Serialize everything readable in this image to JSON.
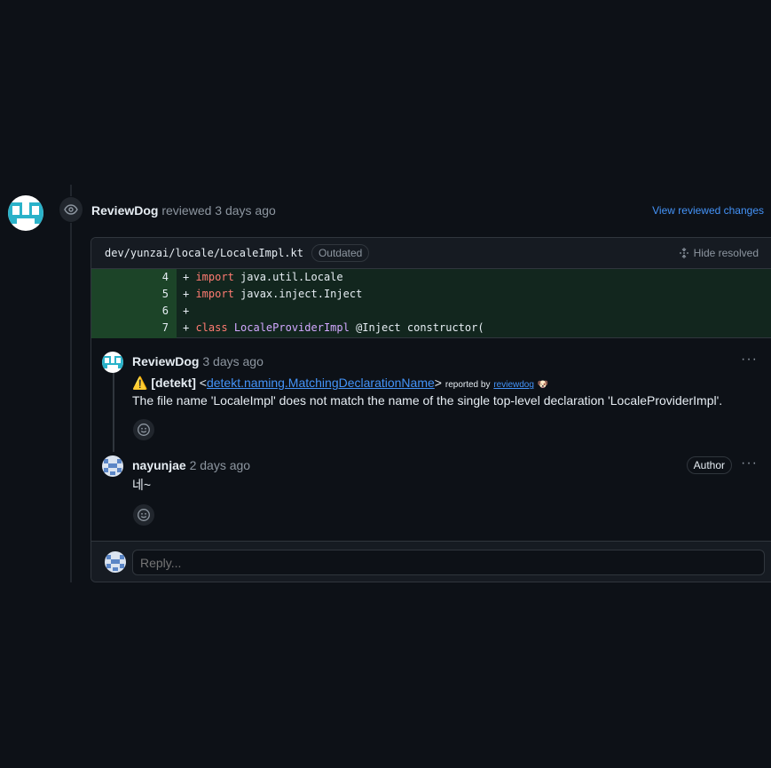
{
  "review": {
    "author": "ReviewDog",
    "action": "reviewed",
    "time": "3 days ago",
    "view_changes_label": "View reviewed changes"
  },
  "file": {
    "path": "dev/yunzai/locale/LocaleImpl.kt",
    "status_badge": "Outdated",
    "hide_resolved_label": "Hide resolved"
  },
  "diff": {
    "lines": [
      {
        "number": "4",
        "prefix": "+ ",
        "keyword": "import",
        "rest": " java.util.Locale"
      },
      {
        "number": "5",
        "prefix": "+ ",
        "keyword": "import",
        "rest": " javax.inject.Inject"
      },
      {
        "number": "6",
        "prefix": "+",
        "keyword": "",
        "rest": ""
      },
      {
        "number": "7",
        "prefix": "+ ",
        "keyword": "class",
        "classname": "LocaleProviderImpl",
        "rest": " @Inject constructor("
      }
    ]
  },
  "comments": [
    {
      "author": "ReviewDog",
      "time": "3 days ago",
      "warning_icon": "⚠️",
      "tag": "[detekt]",
      "open_angle": "<",
      "rule_link": "detekt.naming.MatchingDeclarationName",
      "close_angle": ">",
      "reported_by": "reported by",
      "reporter_link": "reviewdog",
      "reporter_emoji": "🐶",
      "message": "The file name 'LocaleImpl' does not match the name of the single top-level declaration 'LocaleProviderImpl'."
    },
    {
      "author": "nayunjae",
      "time": "2 days ago",
      "badge": "Author",
      "message": "네~"
    }
  ],
  "reply": {
    "placeholder": "Reply..."
  },
  "colors": {
    "background": "#0d1117",
    "link": "#4493f8",
    "diff_added": "#12261e",
    "diff_gutter_added": "#1c4428",
    "keyword": "#ff7b72",
    "class_name": "#d2a8ff",
    "reviewdog_avatar": "#2ab2c9"
  }
}
